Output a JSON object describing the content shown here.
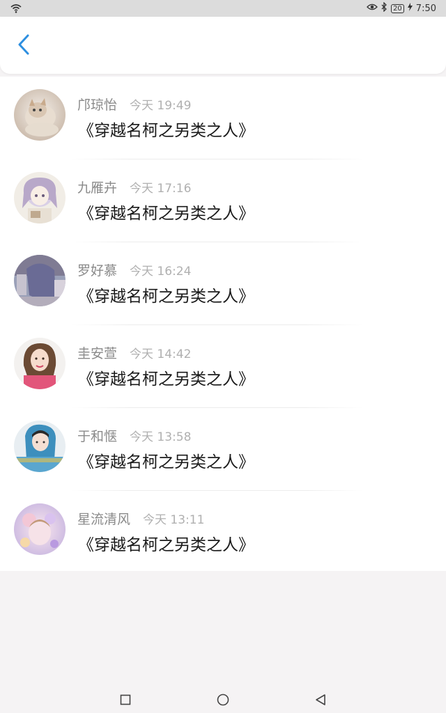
{
  "status_bar": {
    "time": "7:50",
    "battery": "20"
  },
  "header": {
    "back_icon": "chevron-left-icon",
    "accent_color": "#2d8fe0"
  },
  "messages": [
    {
      "name": "邝琼怡",
      "time": "今天 19:49",
      "text": "《穿越名柯之另类之人》"
    },
    {
      "name": "九雁卉",
      "time": "今天 17:16",
      "text": "《穿越名柯之另类之人》"
    },
    {
      "name": "罗好慕",
      "time": "今天 16:24",
      "text": "《穿越名柯之另类之人》"
    },
    {
      "name": "圭安萱",
      "time": "今天 14:42",
      "text": "《穿越名柯之另类之人》"
    },
    {
      "name": "于和惬",
      "time": "今天 13:58",
      "text": "《穿越名柯之另类之人》"
    },
    {
      "name": "星流清风",
      "time": "今天 13:11",
      "text": "《穿越名柯之另类之人》"
    }
  ],
  "nav_bar": {
    "icons": [
      "square-icon",
      "circle-icon",
      "triangle-back-icon"
    ]
  }
}
